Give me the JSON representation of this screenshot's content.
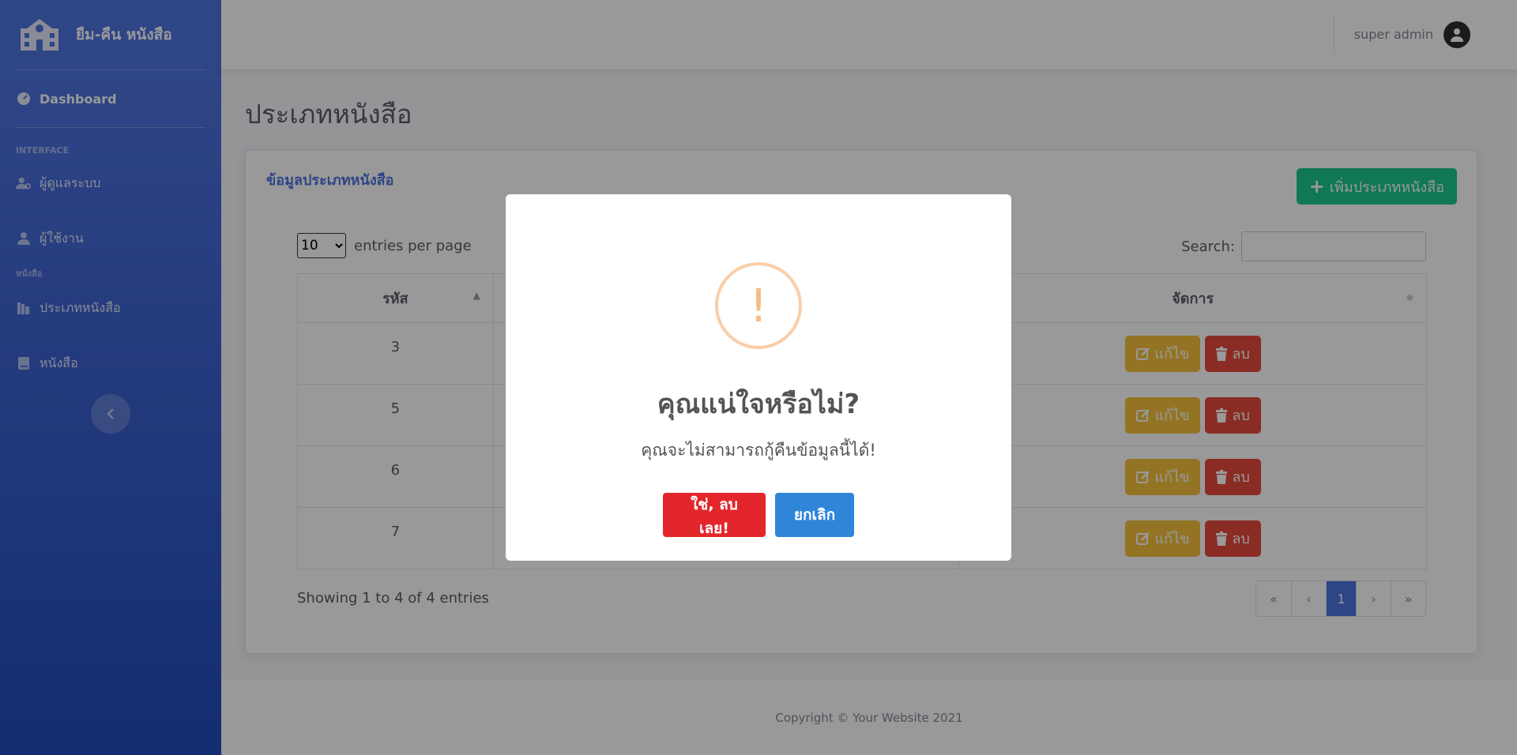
{
  "app": {
    "brand": "ยืม-คืน หนังสือ"
  },
  "sidebar": {
    "dashboard": "Dashboard",
    "section_interface": "INTERFACE",
    "item_admin": "ผู้ดูแลระบบ",
    "item_users": "ผู้ใช้งาน",
    "section_books": "หนังสือ",
    "item_categories": "ประเภทหนังสือ",
    "item_books": "หนังสือ"
  },
  "topbar": {
    "user": "super admin"
  },
  "page": {
    "title": "ประเภทหนังสือ"
  },
  "card": {
    "title": "ข้อมูลประเภทหนังสือ",
    "add_button": "เพิ่มประเภทหนังสือ"
  },
  "datatable": {
    "per_page_value": "10",
    "per_page_label": "entries per page",
    "search_label": "Search:",
    "columns": [
      "รหัส",
      "",
      "จัดการ"
    ],
    "rows": [
      {
        "id": "3"
      },
      {
        "id": "5"
      },
      {
        "id": "6"
      },
      {
        "id": "7"
      }
    ],
    "edit_label": "แก้ไข",
    "delete_label": "ลบ",
    "info": "Showing 1 to 4 of 4 entries",
    "pager": [
      "«",
      "‹",
      "1",
      "›",
      "»"
    ]
  },
  "footer": {
    "copyright": "Copyright © Your Website 2021"
  },
  "modal": {
    "icon": "!",
    "title": "คุณแน่ใจหรือไม่?",
    "text": "คุณจะไม่สามารถกู้คืนข้อมูลนี้ได้!",
    "confirm": "ใช่, ลบเลย!",
    "cancel": "ยกเลิก"
  }
}
